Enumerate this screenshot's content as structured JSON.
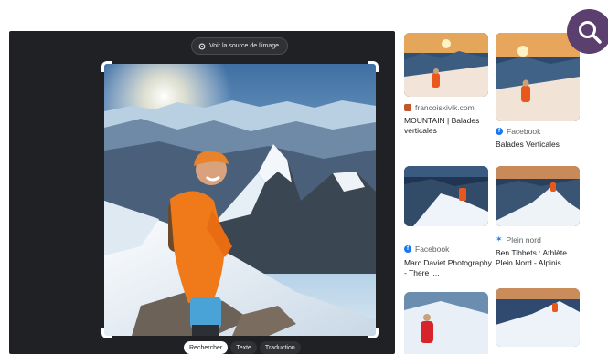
{
  "source_button": {
    "label": "Voir la source de l'image"
  },
  "mode_tabs": [
    {
      "label": "Rechercher",
      "active": true
    },
    {
      "label": "Texte",
      "active": false
    },
    {
      "label": "Traduction",
      "active": false
    }
  ],
  "results": [
    {
      "source": "francoiskivik.com",
      "title": "MOUNTAIN | Balades verticales",
      "favicon": "square-orange"
    },
    {
      "source": "Facebook",
      "title": "Balades Verticales",
      "favicon": "facebook"
    },
    {
      "source": "Facebook",
      "title": "Marc Daviet Photography - There i...",
      "favicon": "facebook"
    },
    {
      "source": "Plein nord",
      "title": "Ben Tibbets : Athlète Plein Nord - Alpinis...",
      "favicon": "star"
    }
  ],
  "colors": {
    "panel": "#202124",
    "fab": "#5b3f6e",
    "facebook": "#1877f2"
  }
}
